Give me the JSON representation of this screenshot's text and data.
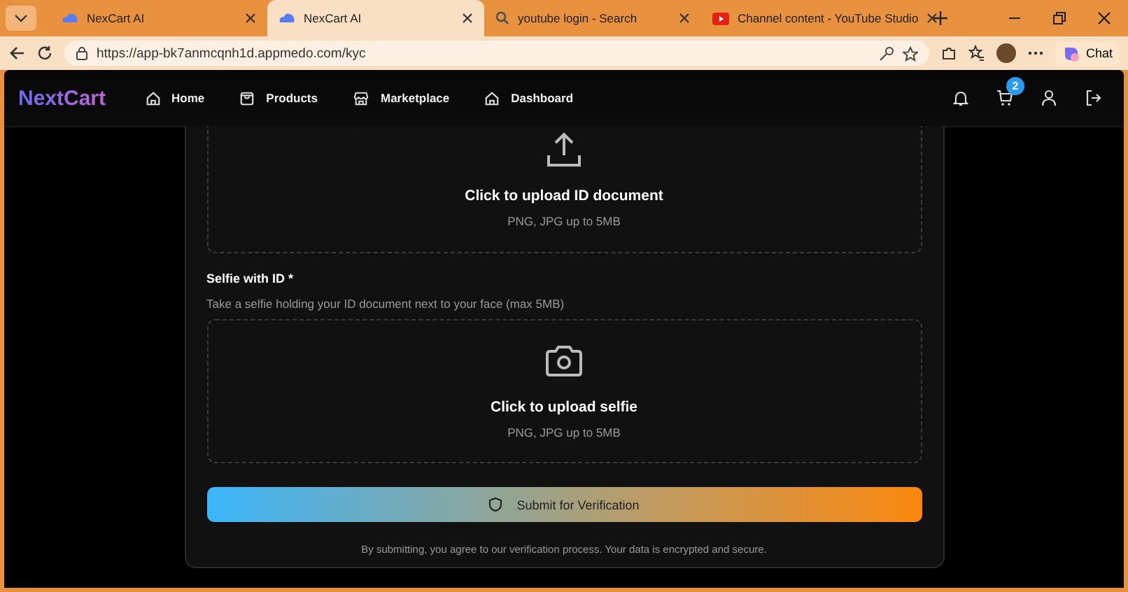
{
  "browser": {
    "tabs": [
      {
        "title": "NexCart AI",
        "kind": "app",
        "selected": false
      },
      {
        "title": "NexCart AI",
        "kind": "app",
        "selected": true
      },
      {
        "title": "youtube login - Search",
        "kind": "search",
        "selected": false
      },
      {
        "title": "Channel content - YouTube Studio",
        "kind": "video",
        "selected": false
      }
    ],
    "url": "https://app-bk7anmcqnh1d.appmedo.com/kyc",
    "chat": "Chat"
  },
  "nav": {
    "logo": "NextCart",
    "links": [
      {
        "label": "Home",
        "kind": "home"
      },
      {
        "label": "Products",
        "kind": "bag"
      },
      {
        "label": "Marketplace",
        "kind": "store"
      },
      {
        "label": "Dashboard",
        "kind": "home"
      }
    ],
    "cart_count": "2"
  },
  "kyc": {
    "id_upload": {
      "title": "Click to upload ID document",
      "hint": "PNG, JPG up to 5MB"
    },
    "selfie": {
      "label": "Selfie with ID",
      "required": "*",
      "description": "Take a selfie holding your ID document next to your face (max 5MB)",
      "title": "Click to upload selfie",
      "hint": "PNG, JPG up to 5MB"
    },
    "submit": "Submit for Verification",
    "footnote": "By submitting, you agree to our verification process. Your data is encrypted and secure."
  }
}
